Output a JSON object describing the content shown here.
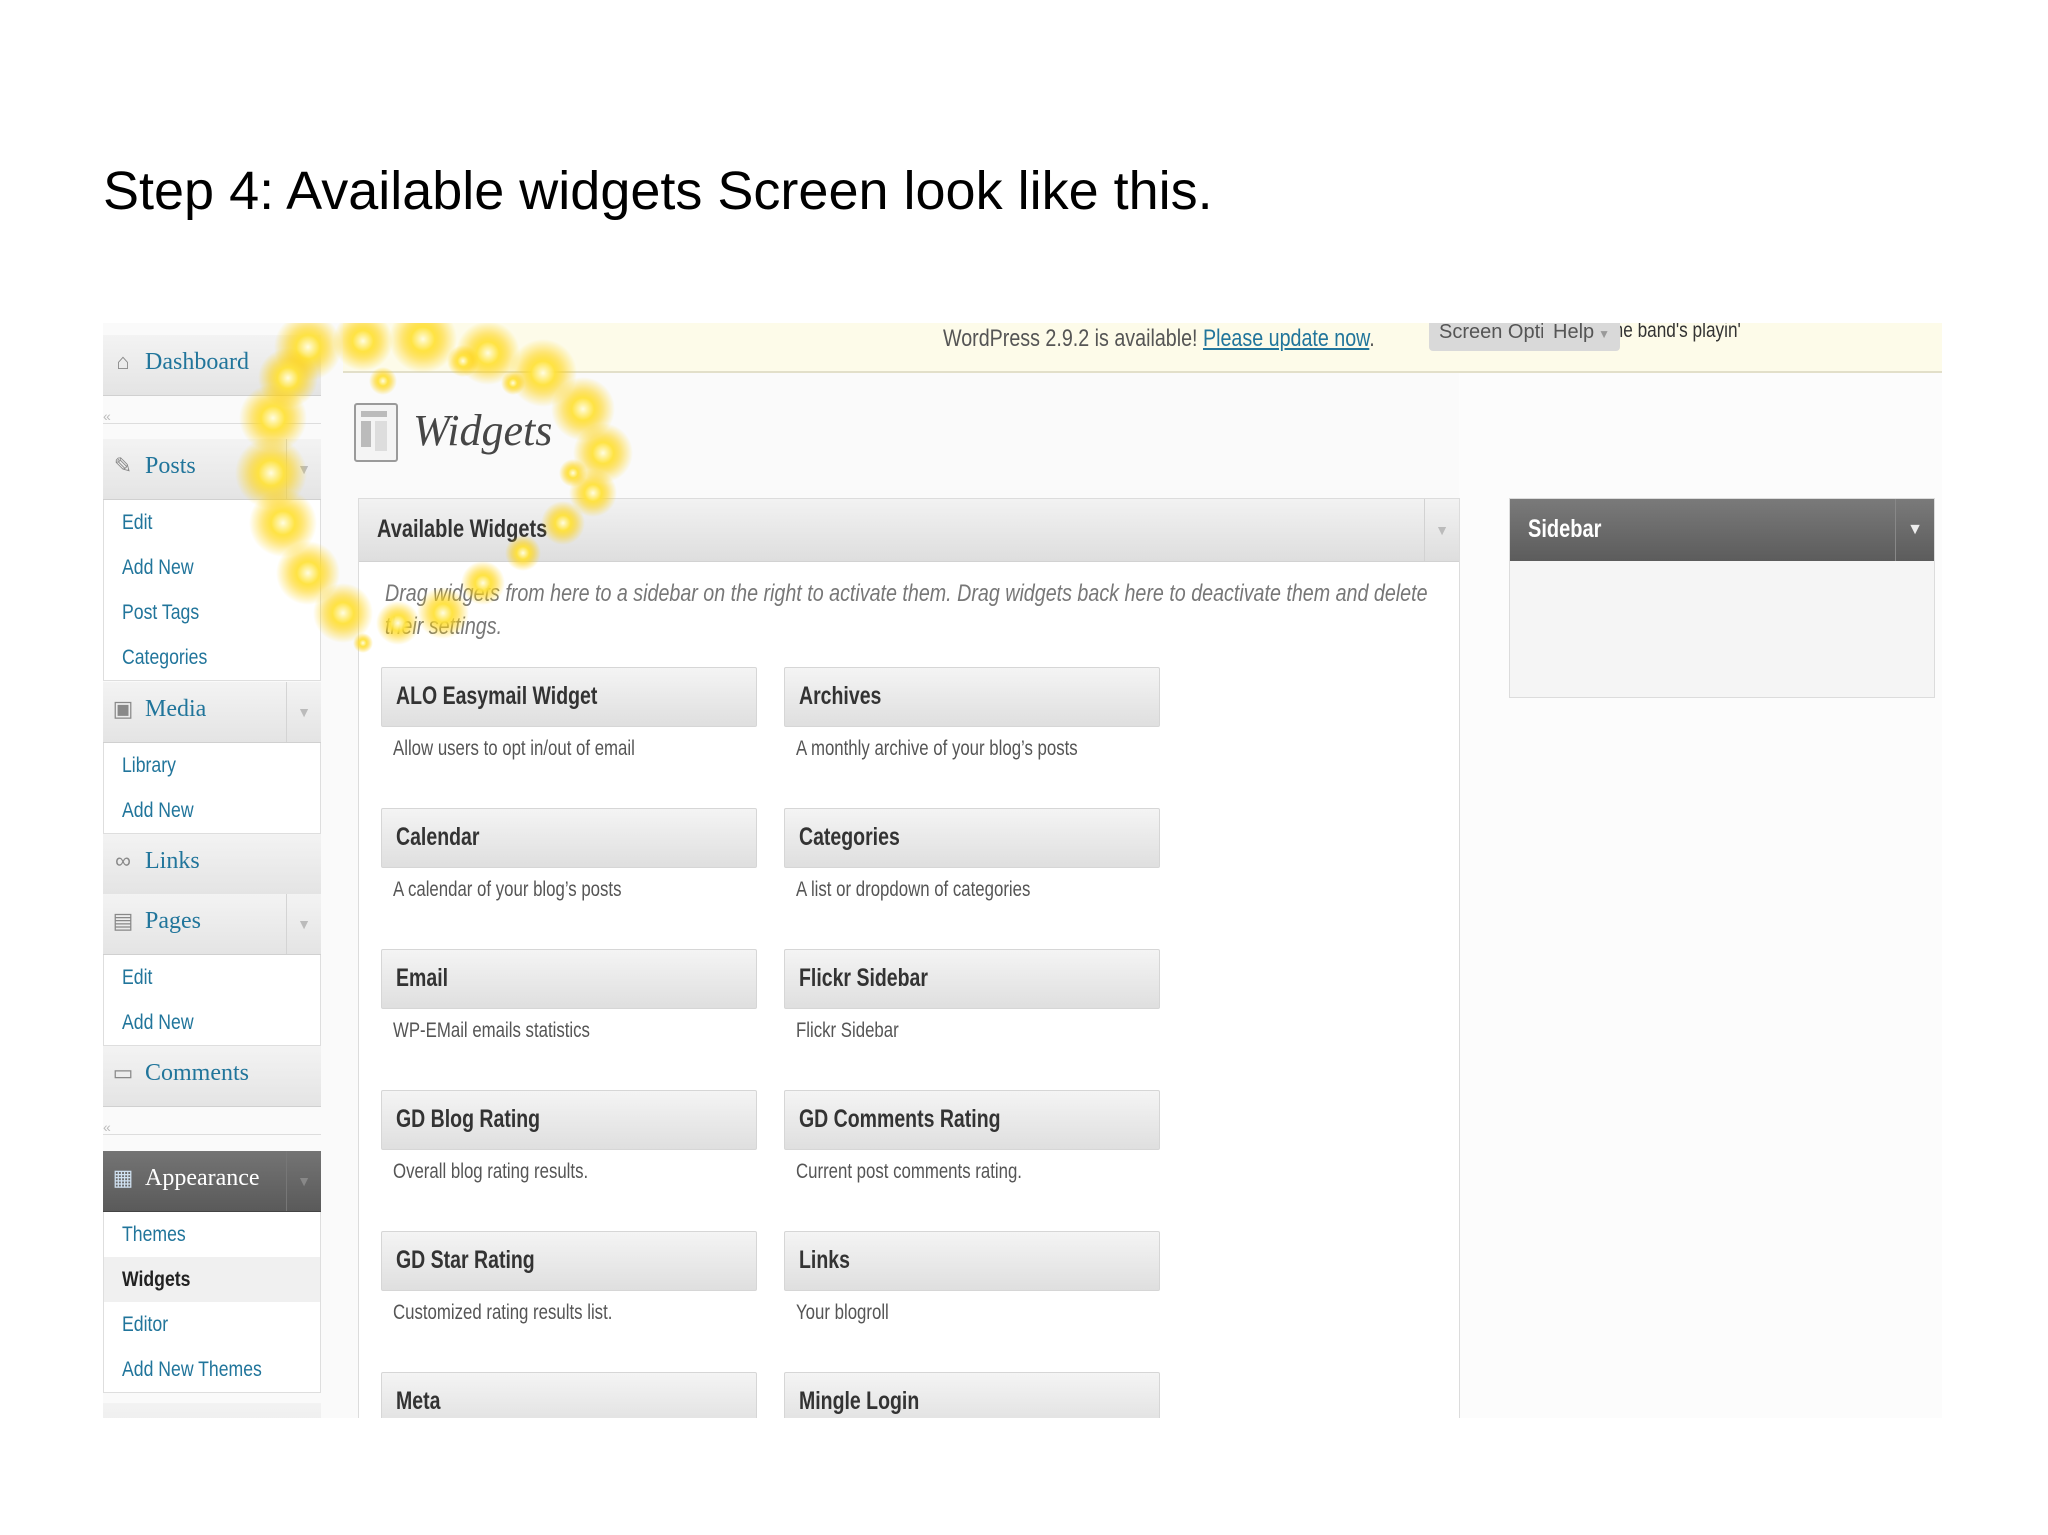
{
  "slide": {
    "title": "Step 4: Available widgets Screen look like this."
  },
  "topbar": {
    "update_text": "WordPress 2.9.2 is available! ",
    "update_link": "Please update now",
    "update_suffix": ".",
    "quote": "While the band's playin'",
    "screen_options": "Screen Options",
    "help": "Help"
  },
  "menu": {
    "dashboard": "Dashboard",
    "posts": {
      "label": "Posts",
      "items": [
        "Edit",
        "Add New",
        "Post Tags",
        "Categories"
      ]
    },
    "media": {
      "label": "Media",
      "items": [
        "Library",
        "Add New"
      ]
    },
    "links": "Links",
    "pages": {
      "label": "Pages",
      "items": [
        "Edit",
        "Add New"
      ]
    },
    "comments": "Comments",
    "appearance": {
      "label": "Appearance",
      "items": [
        "Themes",
        "Widgets",
        "Editor",
        "Add New Themes"
      ]
    }
  },
  "page": {
    "title": "Widgets"
  },
  "available": {
    "title": "Available Widgets",
    "description": "Drag widgets from here to a sidebar on the right to activate them. Drag widgets back here to deactivate them and delete their settings.",
    "widgets": [
      {
        "name": "ALO Easymail Widget",
        "desc": "Allow users to opt in/out of email"
      },
      {
        "name": "Archives",
        "desc": "A monthly archive of your blog’s posts"
      },
      {
        "name": "Calendar",
        "desc": "A calendar of your blog’s posts"
      },
      {
        "name": "Categories",
        "desc": "A list or dropdown of categories"
      },
      {
        "name": "Email",
        "desc": "WP-EMail emails statistics"
      },
      {
        "name": "Flickr Sidebar",
        "desc": "Flickr Sidebar"
      },
      {
        "name": "GD Blog Rating",
        "desc": "Overall blog rating results."
      },
      {
        "name": "GD Comments Rating",
        "desc": "Current post comments rating."
      },
      {
        "name": "GD Star Rating",
        "desc": "Customized rating results list."
      },
      {
        "name": "Links",
        "desc": "Your blogroll"
      },
      {
        "name": "Meta",
        "desc": ""
      },
      {
        "name": "Mingle Login",
        "desc": ""
      }
    ]
  },
  "sidebar": {
    "title": "Sidebar"
  },
  "colors": {
    "link": "#21759b",
    "active_menu": "#5a5a5a",
    "glow": "#ffd21e"
  }
}
